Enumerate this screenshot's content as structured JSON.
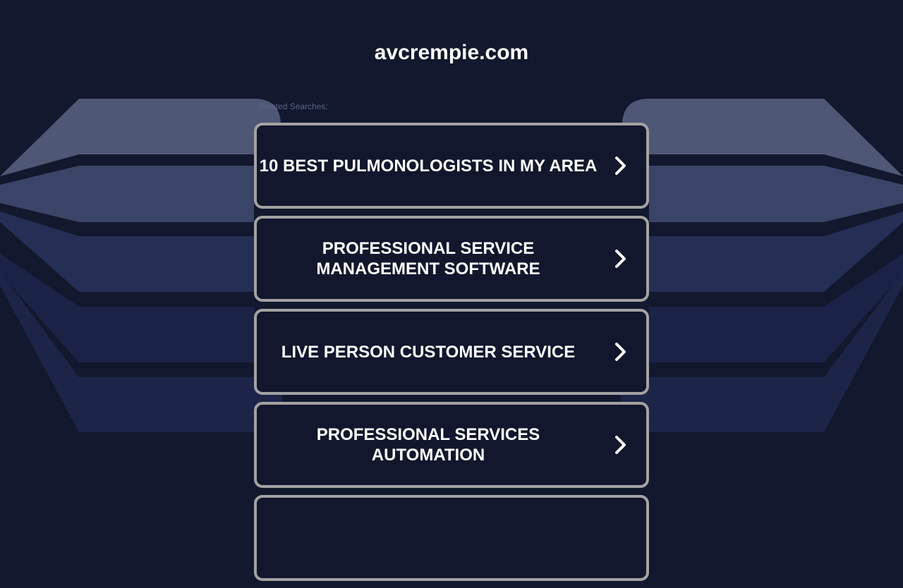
{
  "site": {
    "title": "avcrempie.com"
  },
  "related_searches_label": "Related Searches:",
  "links": [
    {
      "label": "10 BEST PULMONOLOGISTS IN MY AREA"
    },
    {
      "label": "PROFESSIONAL SERVICE MANAGEMENT SOFTWARE"
    },
    {
      "label": "LIVE PERSON CUSTOMER SERVICE"
    },
    {
      "label": "PROFESSIONAL SERVICES AUTOMATION"
    },
    {
      "label": ""
    }
  ],
  "icons": {
    "link_arrow": "chevron-right-icon"
  },
  "colors": {
    "background": "#12182d",
    "link_border": "#a2a2a2",
    "link_background": "#12172d",
    "text": "#ffffff",
    "label_text": "#5a6585"
  }
}
